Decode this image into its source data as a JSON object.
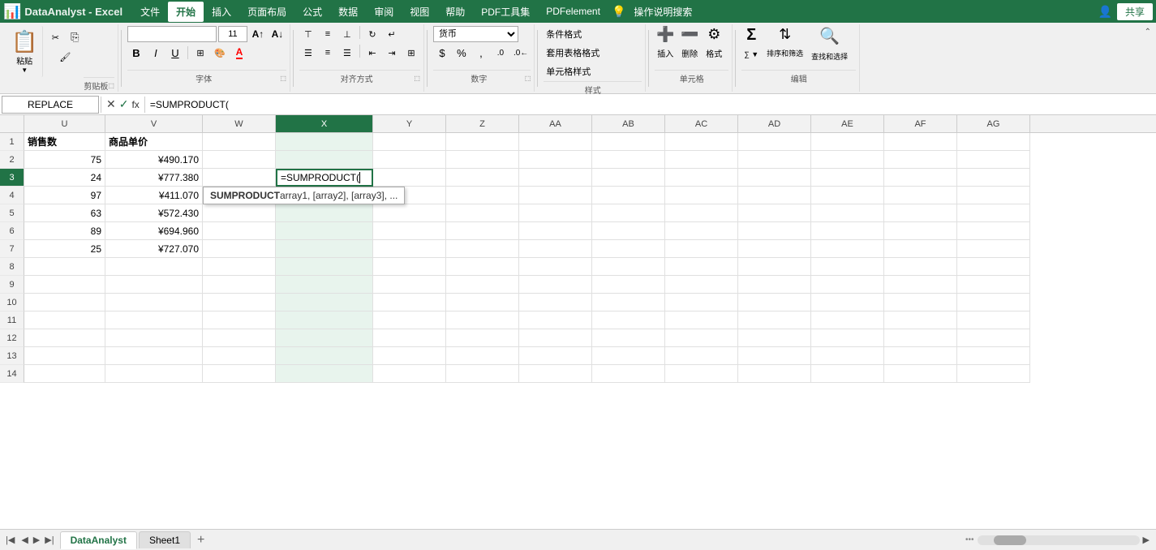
{
  "app": {
    "name": "Excel",
    "title": "DataAnalyst - Excel"
  },
  "menubar": {
    "items": [
      "文件",
      "开始",
      "插入",
      "页面布局",
      "公式",
      "数据",
      "审阅",
      "视图",
      "帮助",
      "PDF工具集",
      "PDFelement"
    ],
    "active": "开始",
    "right_items": [
      "操作说明搜索",
      "共享"
    ]
  },
  "toolbar": {
    "clipboard": {
      "label": "剪贴板",
      "paste": "粘贴",
      "cut": "✂",
      "copy": "⎘",
      "format_painter": "🖌"
    },
    "font": {
      "label": "字体",
      "name": "",
      "size": "11",
      "bold": "B",
      "italic": "I",
      "underline": "U",
      "border": "⊞",
      "fill": "A",
      "color": "A",
      "grow": "A↑",
      "shrink": "A↓"
    },
    "alignment": {
      "label": "对齐方式",
      "top": "⊤",
      "middle": "≡",
      "bottom": "⊥",
      "left": "≡",
      "center": "≡",
      "right": "≡",
      "wrap": "↵",
      "merge": "⊞"
    },
    "number": {
      "label": "数字",
      "format": "货币",
      "percent": "%",
      "comma": ",",
      "increase_decimal": ".0→.00",
      "decrease_decimal": ".00→.0"
    },
    "styles": {
      "label": "样式",
      "conditional": "条件格式",
      "table": "套用表格格式",
      "cell_styles": "单元格样式"
    },
    "cells": {
      "label": "单元格",
      "insert": "插入",
      "delete": "删除",
      "format": "格式"
    },
    "editing": {
      "label": "编辑",
      "sum": "Σ",
      "sort": "AZ↓",
      "find": "🔍",
      "sort_label": "排序和筛选",
      "find_label": "查找和选择"
    }
  },
  "formula_bar": {
    "name_box": "REPLACE",
    "cancel": "✕",
    "confirm": "✓",
    "formula_label": "fx",
    "formula": "=SUMPRODUCT("
  },
  "columns": {
    "headers": [
      "U",
      "V",
      "W",
      "X",
      "Y",
      "Z",
      "AA",
      "AB",
      "AC",
      "AD",
      "AE",
      "AF",
      "AG"
    ],
    "widths": [
      100,
      120,
      90,
      120,
      90,
      90,
      90,
      90,
      90,
      90,
      90,
      90,
      90
    ],
    "active": "X"
  },
  "rows": [
    {
      "num": 1,
      "cells": [
        "销售数",
        "商品单价",
        "",
        "",
        "",
        "",
        "",
        "",
        "",
        "",
        "",
        "",
        ""
      ]
    },
    {
      "num": 2,
      "cells": [
        "75",
        "¥490.170",
        "",
        "",
        "",
        "",
        "",
        "",
        "",
        "",
        "",
        "",
        ""
      ]
    },
    {
      "num": 3,
      "cells": [
        "24",
        "¥777.380",
        "",
        "=SUMPRODUCT(",
        "",
        "",
        "",
        "",
        "",
        "",
        "",
        "",
        ""
      ]
    },
    {
      "num": 4,
      "cells": [
        "97",
        "¥411.070",
        "",
        "",
        "",
        "",
        "",
        "",
        "",
        "",
        "",
        "",
        ""
      ]
    },
    {
      "num": 5,
      "cells": [
        "63",
        "¥572.430",
        "",
        "",
        "",
        "",
        "",
        "",
        "",
        "",
        "",
        "",
        ""
      ]
    },
    {
      "num": 6,
      "cells": [
        "89",
        "¥694.960",
        "",
        "",
        "",
        "",
        "",
        "",
        "",
        "",
        "",
        "",
        ""
      ]
    },
    {
      "num": 7,
      "cells": [
        "25",
        "¥727.070",
        "",
        "",
        "",
        "",
        "",
        "",
        "",
        "",
        "",
        "",
        ""
      ]
    },
    {
      "num": 8,
      "cells": [
        "",
        "",
        "",
        "",
        "",
        "",
        "",
        "",
        "",
        "",
        "",
        "",
        ""
      ]
    },
    {
      "num": 9,
      "cells": [
        "",
        "",
        "",
        "",
        "",
        "",
        "",
        "",
        "",
        "",
        "",
        "",
        ""
      ]
    },
    {
      "num": 10,
      "cells": [
        "",
        "",
        "",
        "",
        "",
        "",
        "",
        "",
        "",
        "",
        "",
        "",
        ""
      ]
    },
    {
      "num": 11,
      "cells": [
        "",
        "",
        "",
        "",
        "",
        "",
        "",
        "",
        "",
        "",
        "",
        "",
        ""
      ]
    },
    {
      "num": 12,
      "cells": [
        "",
        "",
        "",
        "",
        "",
        "",
        "",
        "",
        "",
        "",
        "",
        "",
        ""
      ]
    },
    {
      "num": 13,
      "cells": [
        "",
        "",
        "",
        "",
        "",
        "",
        "",
        "",
        "",
        "",
        "",
        "",
        ""
      ]
    },
    {
      "num": 14,
      "cells": [
        "",
        "",
        "",
        "",
        "",
        "",
        "",
        "",
        "",
        "",
        "",
        "",
        ""
      ]
    }
  ],
  "active_cell": {
    "row": 3,
    "col": "X"
  },
  "formula_tooltip": {
    "text": "SUMPRODUCT(array1, [array2], [array3], ...)",
    "fn_name": "SUMPRODUCT",
    "args": "array1, [array2], [array3], ..."
  },
  "sheet_tabs": {
    "active": "DataAnalyst",
    "tabs": [
      "DataAnalyst",
      "Sheet1"
    ],
    "add_label": "+"
  }
}
